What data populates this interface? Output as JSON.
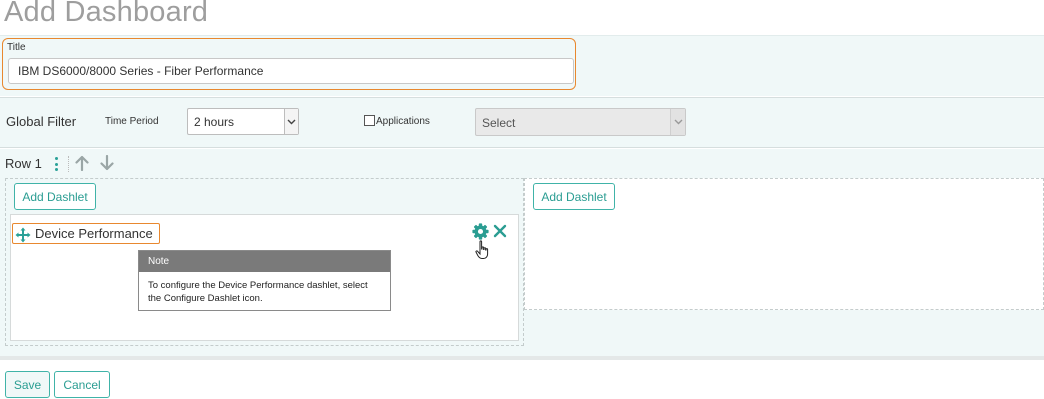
{
  "page": {
    "title": "Add Dashboard"
  },
  "title_field": {
    "label": "Title",
    "value": "IBM DS6000/8000 Series - Fiber Performance"
  },
  "global_filter": {
    "label": "Global Filter",
    "time_period_label": "Time Period",
    "time_period_value": "2 hours",
    "applications_label": "Applications",
    "applications_checked": false,
    "applications_select_value": "Select"
  },
  "row": {
    "label": "Row 1"
  },
  "columns": [
    {
      "add_dashlet_label": "Add Dashlet"
    },
    {
      "add_dashlet_label": "Add Dashlet"
    }
  ],
  "dashlet": {
    "title": "Device Performance",
    "note": {
      "header": "Note",
      "body": "To configure the Device Performance dashlet, select the Configure Dashlet icon."
    }
  },
  "actions": {
    "save_label": "Save",
    "cancel_label": "Cancel"
  },
  "colors": {
    "accent": "#2aa198",
    "highlight": "#e8882f",
    "band": "#f0f8f8",
    "note_header": "#7a7a7a"
  },
  "icons": [
    "move-icon",
    "gear-icon",
    "close-icon",
    "arrow-up-icon",
    "arrow-down-icon",
    "vertical-dots-icon",
    "hand-cursor-icon",
    "chevron-down-icon"
  ]
}
